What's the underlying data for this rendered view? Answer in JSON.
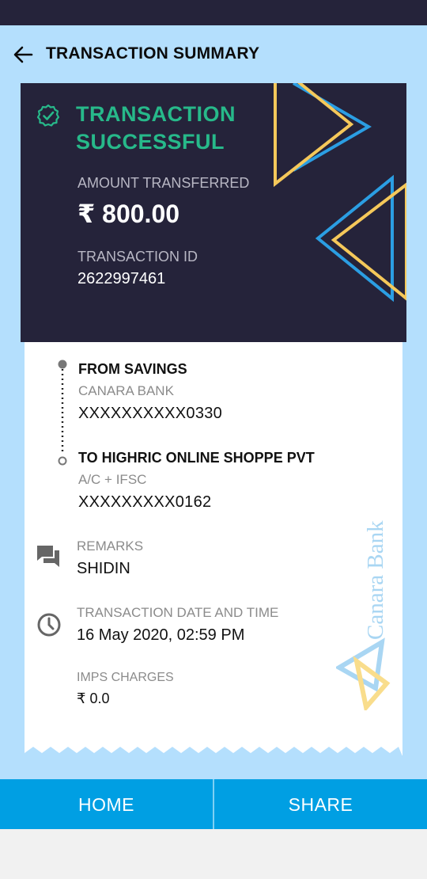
{
  "header": {
    "title": "TRANSACTION SUMMARY",
    "back_icon": "arrow-left-icon"
  },
  "status": {
    "line1": "TRANSACTION",
    "line2": "SUCCESSFUL",
    "icon": "check-circle-icon",
    "color": "#27b98a"
  },
  "amount": {
    "label": "AMOUNT TRANSFERRED",
    "value": "₹ 800.00"
  },
  "transaction_id": {
    "label": "TRANSACTION ID",
    "value": "2622997461"
  },
  "from": {
    "title": "FROM SAVINGS",
    "bank": "CANARA BANK",
    "account": "XXXXXXXXXX0330"
  },
  "to": {
    "title": "TO HIGHRIC ONLINE SHOPPE PVT",
    "type": "A/C + IFSC",
    "account": "XXXXXXXXX0162"
  },
  "remarks": {
    "label": "REMARKS",
    "value": "SHIDIN",
    "icon": "chat-bubbles-icon"
  },
  "datetime": {
    "label": "TRANSACTION DATE AND TIME",
    "value": "16 May 2020, 02:59 PM",
    "icon": "clock-icon"
  },
  "charges": {
    "label": "IMPS CHARGES",
    "value": "₹ 0.0"
  },
  "watermark": {
    "text": "Canara Bank"
  },
  "buttons": {
    "home": "HOME",
    "share": "SHARE"
  },
  "colors": {
    "dark": "#25233a",
    "accent_green": "#27b98a",
    "light_blue_bg": "#b4dffd",
    "button_blue": "#009fe3",
    "deco_blue": "#2b9ee3",
    "deco_yellow": "#f5c85a"
  }
}
